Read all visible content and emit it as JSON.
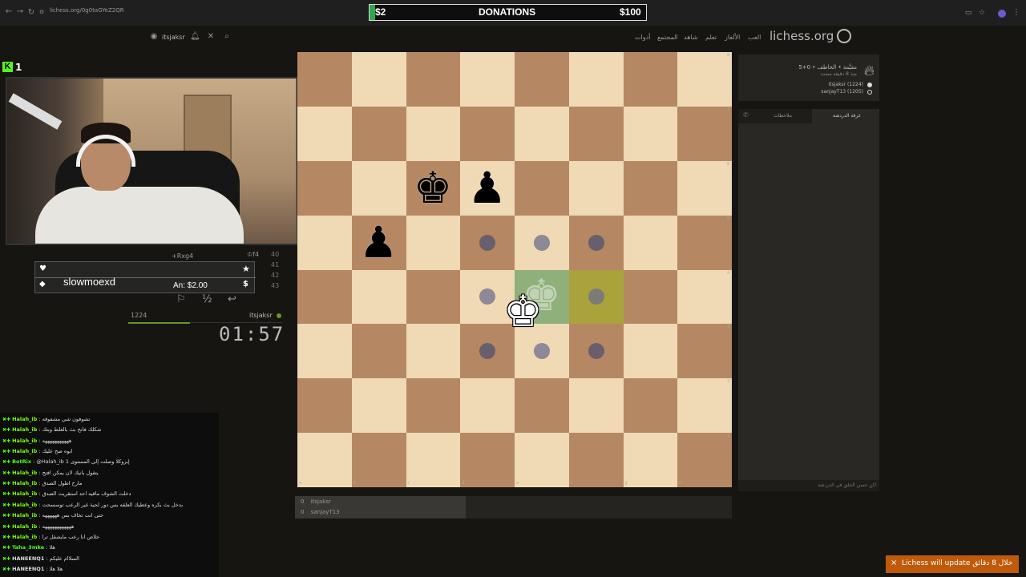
{
  "browser": {
    "url": "lichess.org/0g0taGYeZ2QR",
    "back": "←",
    "forward": "→",
    "reload": "↻",
    "icons": [
      "cast-icon",
      "star-icon",
      "extensions-icon",
      "profile-icon",
      "menu-icon"
    ]
  },
  "donations": {
    "left": "$2",
    "title": "DONATIONS",
    "right": "$100",
    "progress": 0.02
  },
  "header": {
    "logo": "lichess.org",
    "nav": [
      "العب",
      "الألغاز",
      "تعلم",
      "شاهد",
      "المجتمع",
      "أدوات"
    ],
    "user": "itsjaksr"
  },
  "stream": {
    "kick_badge": "K",
    "viewer_count": "1",
    "donor": {
      "name": "slowmoexd",
      "amount": "An: $2.00",
      "ghost_move": "+Rxg4"
    }
  },
  "moves": {
    "rows": [
      {
        "num": "40",
        "san": "♔f4"
      },
      {
        "num": "41",
        "san": ""
      },
      {
        "num": "42",
        "san": ""
      },
      {
        "num": "43",
        "san": ""
      }
    ],
    "flag": "⚐",
    "draw": "½",
    "takeback": "↩"
  },
  "player_clock": {
    "rating": "1224",
    "name": "itsjaksr",
    "time": "01:57"
  },
  "chat": [
    {
      "user": "Halah_ib",
      "msg": "تشوفون شي مشفوقه"
    },
    {
      "user": "Halah_ib",
      "msg": "شكلك فاتح بث بالغلط وبتك"
    },
    {
      "user": "Halah_ib",
      "msg": "هههههههههههه"
    },
    {
      "user": "Halah_ib",
      "msg": "ايوه صح عليك"
    },
    {
      "user": "BotRix",
      "msg": "@Halah_ib 1 إبروكلا وصلت إلى المستوى"
    },
    {
      "user": "Halah_ib",
      "msg": "يتقول بانيك لان يمكن افتح"
    },
    {
      "user": "Halah_ib",
      "msg": "مارح اطول الصدق"
    },
    {
      "user": "Halah_ib",
      "msg": "دخلت الشوف ماقيه احد استقريت الصدق"
    },
    {
      "user": "Halah_ib",
      "msg": "بدخل بث بكره وعطيك العلقه بس دور لحية غير الرعب توسسحت"
    },
    {
      "user": "Halah_ib",
      "msg": "حتى انت تخاف بس ههههههه"
    },
    {
      "user": "Halah_ib",
      "msg": "ههههههههههههه"
    },
    {
      "user": "Halah_ib",
      "msg": "خلاص انا رعب مايشقل ترا"
    },
    {
      "user": "Taha_3mke",
      "msg": "هلا"
    },
    {
      "user": "HANEENQ1",
      "msg": "السلاام عليكم"
    },
    {
      "user": "HANEENQ1",
      "msg": "هلا هلا"
    },
    {
      "user": "HANEENQ1",
      "msg": ""
    }
  ],
  "board": {
    "files": [
      "a",
      "b",
      "c",
      "d",
      "e",
      "f",
      "g",
      "h"
    ],
    "ranks": [
      "8",
      "7",
      "6",
      "5",
      "4",
      "3",
      "2",
      "1"
    ],
    "pieces": [
      {
        "type": "king",
        "color": "black",
        "glyph": "♚",
        "square": "c6"
      },
      {
        "type": "pawn",
        "color": "black",
        "glyph": "♟",
        "square": "d6"
      },
      {
        "type": "pawn",
        "color": "black",
        "glyph": "♟",
        "square": "b5"
      },
      {
        "type": "king",
        "color": "white",
        "glyph": "♚",
        "square": "e4"
      }
    ],
    "last_move": [
      "e4",
      "f4"
    ],
    "move_dots": [
      "d5",
      "e5",
      "f5",
      "d4",
      "f4",
      "d3",
      "e3",
      "f3"
    ]
  },
  "board_players": [
    {
      "score": "0",
      "name": "itsjaksr"
    },
    {
      "score": "0",
      "name": "sanjayT13"
    }
  ],
  "game_info": {
    "title": "5+0 • مقيَّمة • الخاطف",
    "subtitle": "منذ 8 دقيقة مضت",
    "white": "itsjaksr (1224)",
    "black": "sanjayT13 (1205)"
  },
  "chat_panel": {
    "tab_room": "غرفة الدردشة",
    "tab_notes": "ملاحظات",
    "placeholder": "كن حسن الخلق في الدردشة!"
  },
  "toast": {
    "text": "Lichess will update خلال 8 دقائق",
    "close": "×"
  }
}
